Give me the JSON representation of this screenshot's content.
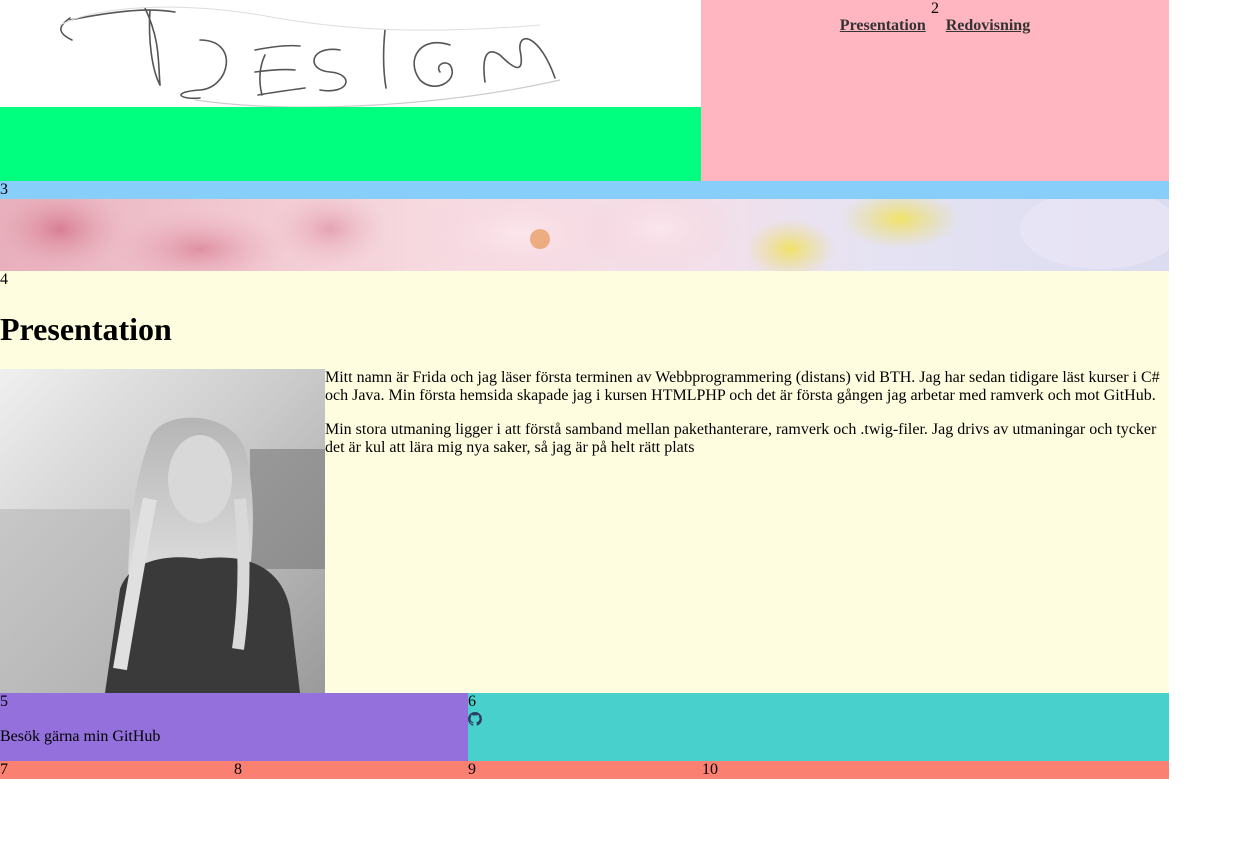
{
  "header": {
    "logo_text": "DESIGN",
    "region_number": "2",
    "nav": [
      {
        "label": "Presentation"
      },
      {
        "label": "Redovisning"
      }
    ]
  },
  "banner": {
    "region_number": "3"
  },
  "main": {
    "region_number": "4",
    "title": "Presentation",
    "paragraphs": [
      "Mitt namn är Frida och jag läser första terminen av Webbprogrammering (distans) vid BTH. Jag har sedan tidigare läst kurser i C# och Java. Min första hemsida skapade jag i kursen HTMLPHP och det är första gången jag arbetar med ramverk och mot GitHub.",
      "Min stora utmaning ligger i att förstå samband mellan pakethanterare, ramverk och .twig-filer. Jag drivs av utmaningar och tycker det är kul att lära mig nya saker, så jag är på helt rätt plats"
    ]
  },
  "footer_left": {
    "region_number": "5",
    "text": "Besök gärna min GitHub"
  },
  "footer_right": {
    "region_number": "6",
    "icon": "github-icon"
  },
  "bottom_bar": {
    "numbers": [
      "7",
      "8",
      "9",
      "10"
    ]
  },
  "colors": {
    "green": "#00ff7f",
    "pink": "#ffb6c1",
    "light_blue": "#87cefa",
    "light_yellow": "#fffde0",
    "purple": "#9370db",
    "teal": "#48d1cc",
    "salmon": "#fa8072"
  }
}
